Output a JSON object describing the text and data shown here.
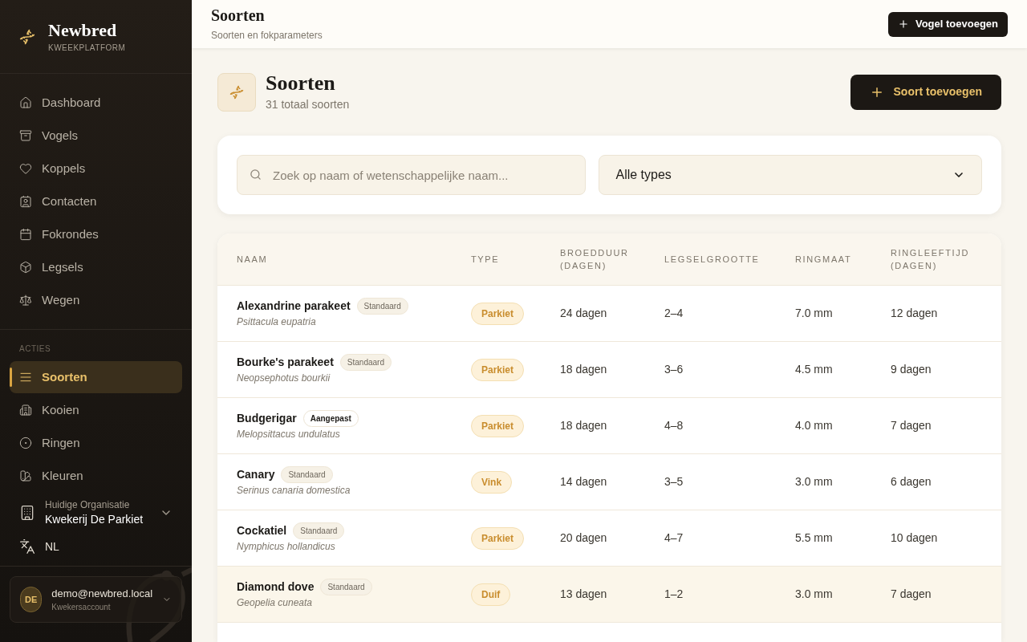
{
  "brand": {
    "name": "Newbred",
    "tagline": "KWEEKPLATFORM"
  },
  "sidebar": {
    "items": [
      {
        "label": "Dashboard",
        "selected": false
      },
      {
        "label": "Vogels",
        "selected": false
      },
      {
        "label": "Koppels",
        "selected": false
      },
      {
        "label": "Contacten",
        "selected": false
      },
      {
        "label": "Fokrondes",
        "selected": false
      },
      {
        "label": "Legsels",
        "selected": false
      },
      {
        "label": "Wegen",
        "selected": false
      }
    ],
    "section_title": "ACTIES",
    "actions": [
      {
        "label": "Soorten",
        "selected": true
      },
      {
        "label": "Kooien",
        "selected": false
      },
      {
        "label": "Ringen",
        "selected": false
      },
      {
        "label": "Kleuren",
        "selected": false
      }
    ],
    "organization": {
      "label": "Huidige Organisatie",
      "value": "Kwekerij De Parkiet"
    },
    "language": "NL",
    "user": {
      "initials": "DE",
      "email": "demo@newbred.local",
      "role": "Kwekersaccount"
    }
  },
  "header": {
    "title": "Soorten",
    "subtitle": "Soorten en fokparameters",
    "button": "Vogel toevoegen"
  },
  "page": {
    "title": "Soorten",
    "count": "31 totaal soorten",
    "button": "Soort toevoegen"
  },
  "filters": {
    "search_placeholder": "Zoek op naam of wetenschappelijke naam...",
    "type_select": "Alle types"
  },
  "table": {
    "columns": [
      "NAAM",
      "TYPE",
      "BROEDDUUR (DAGEN)",
      "LEGSELGROOTTE",
      "RINGMAAT",
      "RINGLEEFTIJD (DAGEN)"
    ],
    "rows": [
      {
        "name": "Alexandrine parakeet",
        "badge": {
          "label": "Standaard",
          "kind": "standard"
        },
        "scientific": "Psittacula eupatria",
        "type": "Parkiet",
        "incubation": "24 dagen",
        "clutch": "2–4",
        "ring_size": "7.0 mm",
        "ring_age": "12 dagen",
        "highlighted": false
      },
      {
        "name": "Bourke's parakeet",
        "badge": {
          "label": "Standaard",
          "kind": "standard"
        },
        "scientific": "Neopsephotus bourkii",
        "type": "Parkiet",
        "incubation": "18 dagen",
        "clutch": "3–6",
        "ring_size": "4.5 mm",
        "ring_age": "9 dagen",
        "highlighted": false
      },
      {
        "name": "Budgerigar",
        "badge": {
          "label": "Aangepast",
          "kind": "custom"
        },
        "scientific": "Melopsittacus undulatus",
        "type": "Parkiet",
        "incubation": "18 dagen",
        "clutch": "4–8",
        "ring_size": "4.0 mm",
        "ring_age": "7 dagen",
        "highlighted": false
      },
      {
        "name": "Canary",
        "badge": {
          "label": "Standaard",
          "kind": "standard"
        },
        "scientific": "Serinus canaria domestica",
        "type": "Vink",
        "incubation": "14 dagen",
        "clutch": "3–5",
        "ring_size": "3.0 mm",
        "ring_age": "6 dagen",
        "highlighted": false
      },
      {
        "name": "Cockatiel",
        "badge": {
          "label": "Standaard",
          "kind": "standard"
        },
        "scientific": "Nymphicus hollandicus",
        "type": "Parkiet",
        "incubation": "20 dagen",
        "clutch": "4–7",
        "ring_size": "5.5 mm",
        "ring_age": "10 dagen",
        "highlighted": false
      },
      {
        "name": "Diamond dove",
        "badge": {
          "label": "Standaard",
          "kind": "standard"
        },
        "scientific": "Geopelia cuneata",
        "type": "Duif",
        "incubation": "13 dagen",
        "clutch": "1–2",
        "ring_size": "3.0 mm",
        "ring_age": "7 dagen",
        "highlighted": true
      }
    ]
  }
}
